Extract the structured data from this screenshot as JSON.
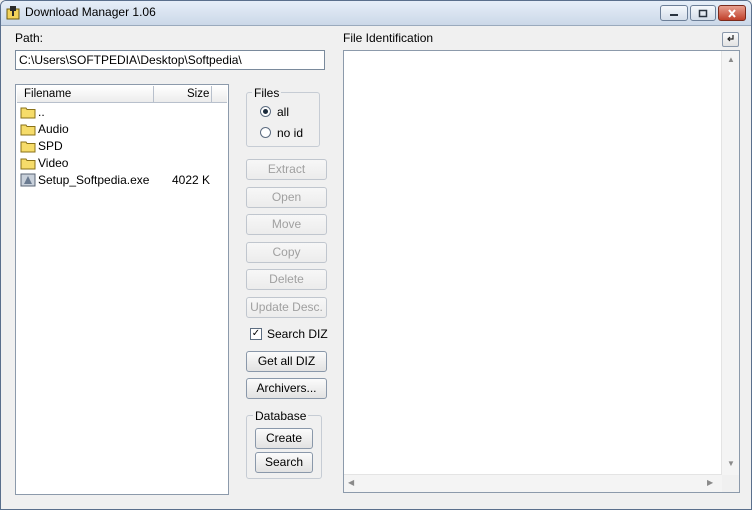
{
  "window": {
    "title": "Download Manager 1.06",
    "icons": {
      "app": "folder-download-icon",
      "minimize": "minimize-icon",
      "maximize": "maximize-icon",
      "close": "close-icon"
    }
  },
  "path": {
    "label": "Path:",
    "value": "C:\\Users\\SOFTPEDIA\\Desktop\\Softpedia\\"
  },
  "file_list": {
    "columns": [
      "Filename",
      "Size"
    ],
    "rows": [
      {
        "name": "..",
        "size": "",
        "icon": "folder-icon"
      },
      {
        "name": "Audio",
        "size": "",
        "icon": "folder-icon"
      },
      {
        "name": "SPD",
        "size": "",
        "icon": "folder-icon"
      },
      {
        "name": "Video",
        "size": "",
        "icon": "folder-icon"
      },
      {
        "name": "Setup_Softpedia.exe",
        "size": "4022 K",
        "icon": "exe-file-icon"
      }
    ]
  },
  "files_group": {
    "label": "Files",
    "options": [
      {
        "label": "all",
        "selected": true
      },
      {
        "label": "no id",
        "selected": false
      }
    ]
  },
  "actions": {
    "extract": "Extract",
    "open": "Open",
    "move": "Move",
    "copy": "Copy",
    "delete": "Delete",
    "update_desc": "Update Desc.",
    "get_all_diz": "Get all DIZ",
    "archivers": "Archivers..."
  },
  "search_diz": {
    "label": "Search DIZ",
    "checked": true
  },
  "database": {
    "label": "Database",
    "create": "Create",
    "search": "Search"
  },
  "identification": {
    "label": "File Identification",
    "toggle_icon": "return-arrow-icon"
  }
}
